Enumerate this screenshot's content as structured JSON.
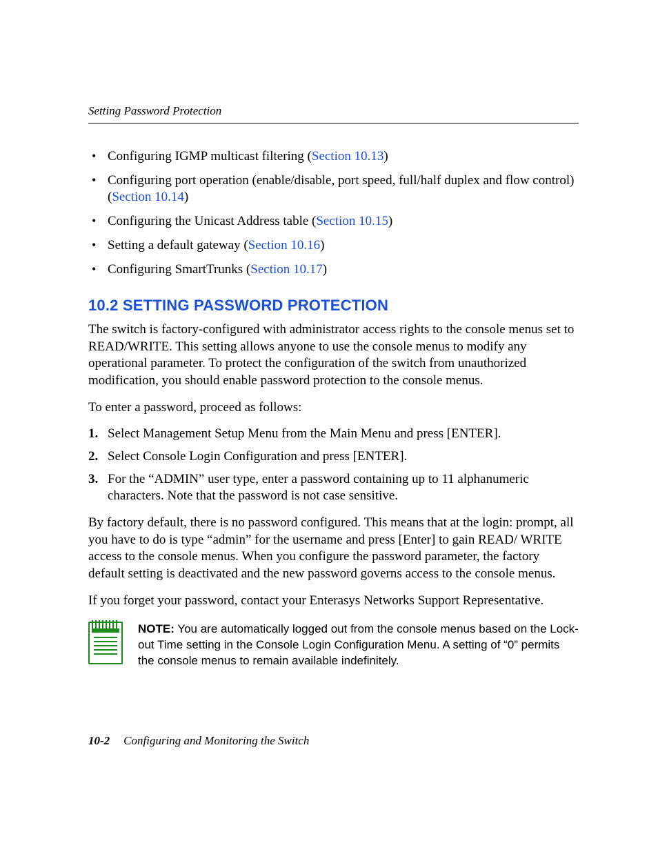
{
  "running_head": "Setting Password Protection",
  "bullets": [
    {
      "pre": "Configuring IGMP multicast filtering (",
      "link": "Section 10.13",
      "post": ")"
    },
    {
      "pre": "Configuring port operation (enable/disable, port speed, full/half duplex and flow control) (",
      "link": "Section 10.14",
      "post": ")"
    },
    {
      "pre": "Configuring the Unicast Address table (",
      "link": "Section 10.15",
      "post": ")"
    },
    {
      "pre": "Setting a default gateway (",
      "link": "Section 10.16",
      "post": ")"
    },
    {
      "pre": "Configuring SmartTrunks (",
      "link": "Section 10.17",
      "post": ")"
    }
  ],
  "section_heading": "10.2   SETTING PASSWORD PROTECTION",
  "para1": "The switch is factory-configured with administrator access rights to the console menus set to READ/WRITE. This setting allows anyone to use the console menus to modify any operational parameter. To protect the configuration of the switch from unauthorized modification, you should enable password protection to the console menus.",
  "para2": "To enter a password, proceed as follows:",
  "steps": [
    "Select Management Setup Menu from the Main Menu and press [ENTER].",
    "Select Console Login Configuration and press [ENTER].",
    "For the “ADMIN” user type, enter a password containing up to 11 alphanumeric characters. Note that the password is not case sensitive."
  ],
  "para3": "By factory default, there is no password configured. This means that at the login: prompt, all you have to do is type “admin” for the username and press [Enter] to gain READ/ WRITE access to the console menus. When you configure the password parameter, the factory default setting is deactivated and the new password governs access to the console menus.",
  "para4": "If you forget your password, contact your Enterasys Networks Support Representative.",
  "note_label": "NOTE:",
  "note_body": "  You are automatically logged out from the console menus based on the Lock-out Time setting in the Console Login Configuration Menu. A setting of “0” permits the console menus to remain available indefinitely.",
  "footer_page": "10-2",
  "footer_chapter": "Configuring and Monitoring the Switch"
}
